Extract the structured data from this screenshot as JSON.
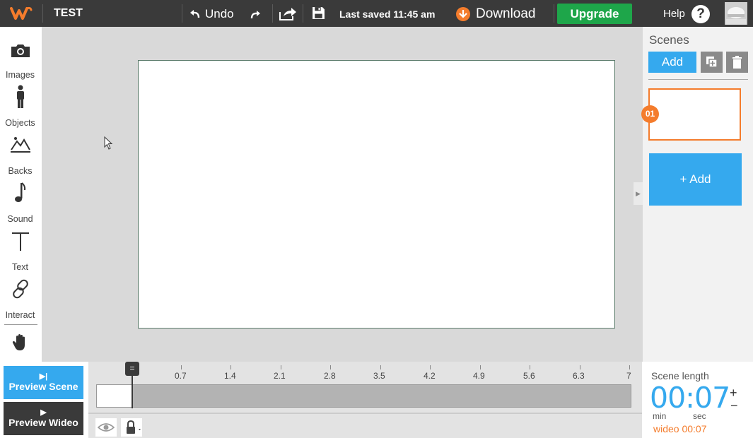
{
  "header": {
    "project_title": "TEST",
    "undo_label": "Undo",
    "last_saved": "Last saved 11:45 am",
    "download_label": "Download",
    "upgrade_label": "Upgrade",
    "help_label": "Help",
    "help_glyph": "?"
  },
  "tools": [
    {
      "label": "Images",
      "icon": "camera-icon"
    },
    {
      "label": "Objects",
      "icon": "person-icon"
    },
    {
      "label": "Backs",
      "icon": "mountain-icon"
    },
    {
      "label": "Sound",
      "icon": "music-note-icon"
    },
    {
      "label": "Text",
      "icon": "text-icon"
    },
    {
      "label": "Interact",
      "icon": "link-icon"
    }
  ],
  "scenes_panel": {
    "title": "Scenes",
    "add_label": "Add",
    "scene_number": "01",
    "add_scene_label": "+ Add"
  },
  "preview": {
    "scene_label": "Preview Scene",
    "scene_glyph": "▶|",
    "wideo_label": "Preview Wideo",
    "wideo_glyph": "▶"
  },
  "timeline": {
    "ticks": [
      "0.7",
      "1.4",
      "2.1",
      "2.8",
      "3.5",
      "4.2",
      "4.9",
      "5.6",
      "6.3",
      "7"
    ],
    "playhead_glyph": "="
  },
  "scene_length": {
    "label": "Scene length",
    "time": "00:07",
    "min_label": "min",
    "sec_label": "sec",
    "wideo_total": "wideo 00:07",
    "plus": "+",
    "minus": "−"
  },
  "colors": {
    "accent_blue": "#35a9ee",
    "accent_orange": "#f47c2c",
    "upgrade_green": "#1ea64a",
    "topbar": "#3a3a3a"
  }
}
